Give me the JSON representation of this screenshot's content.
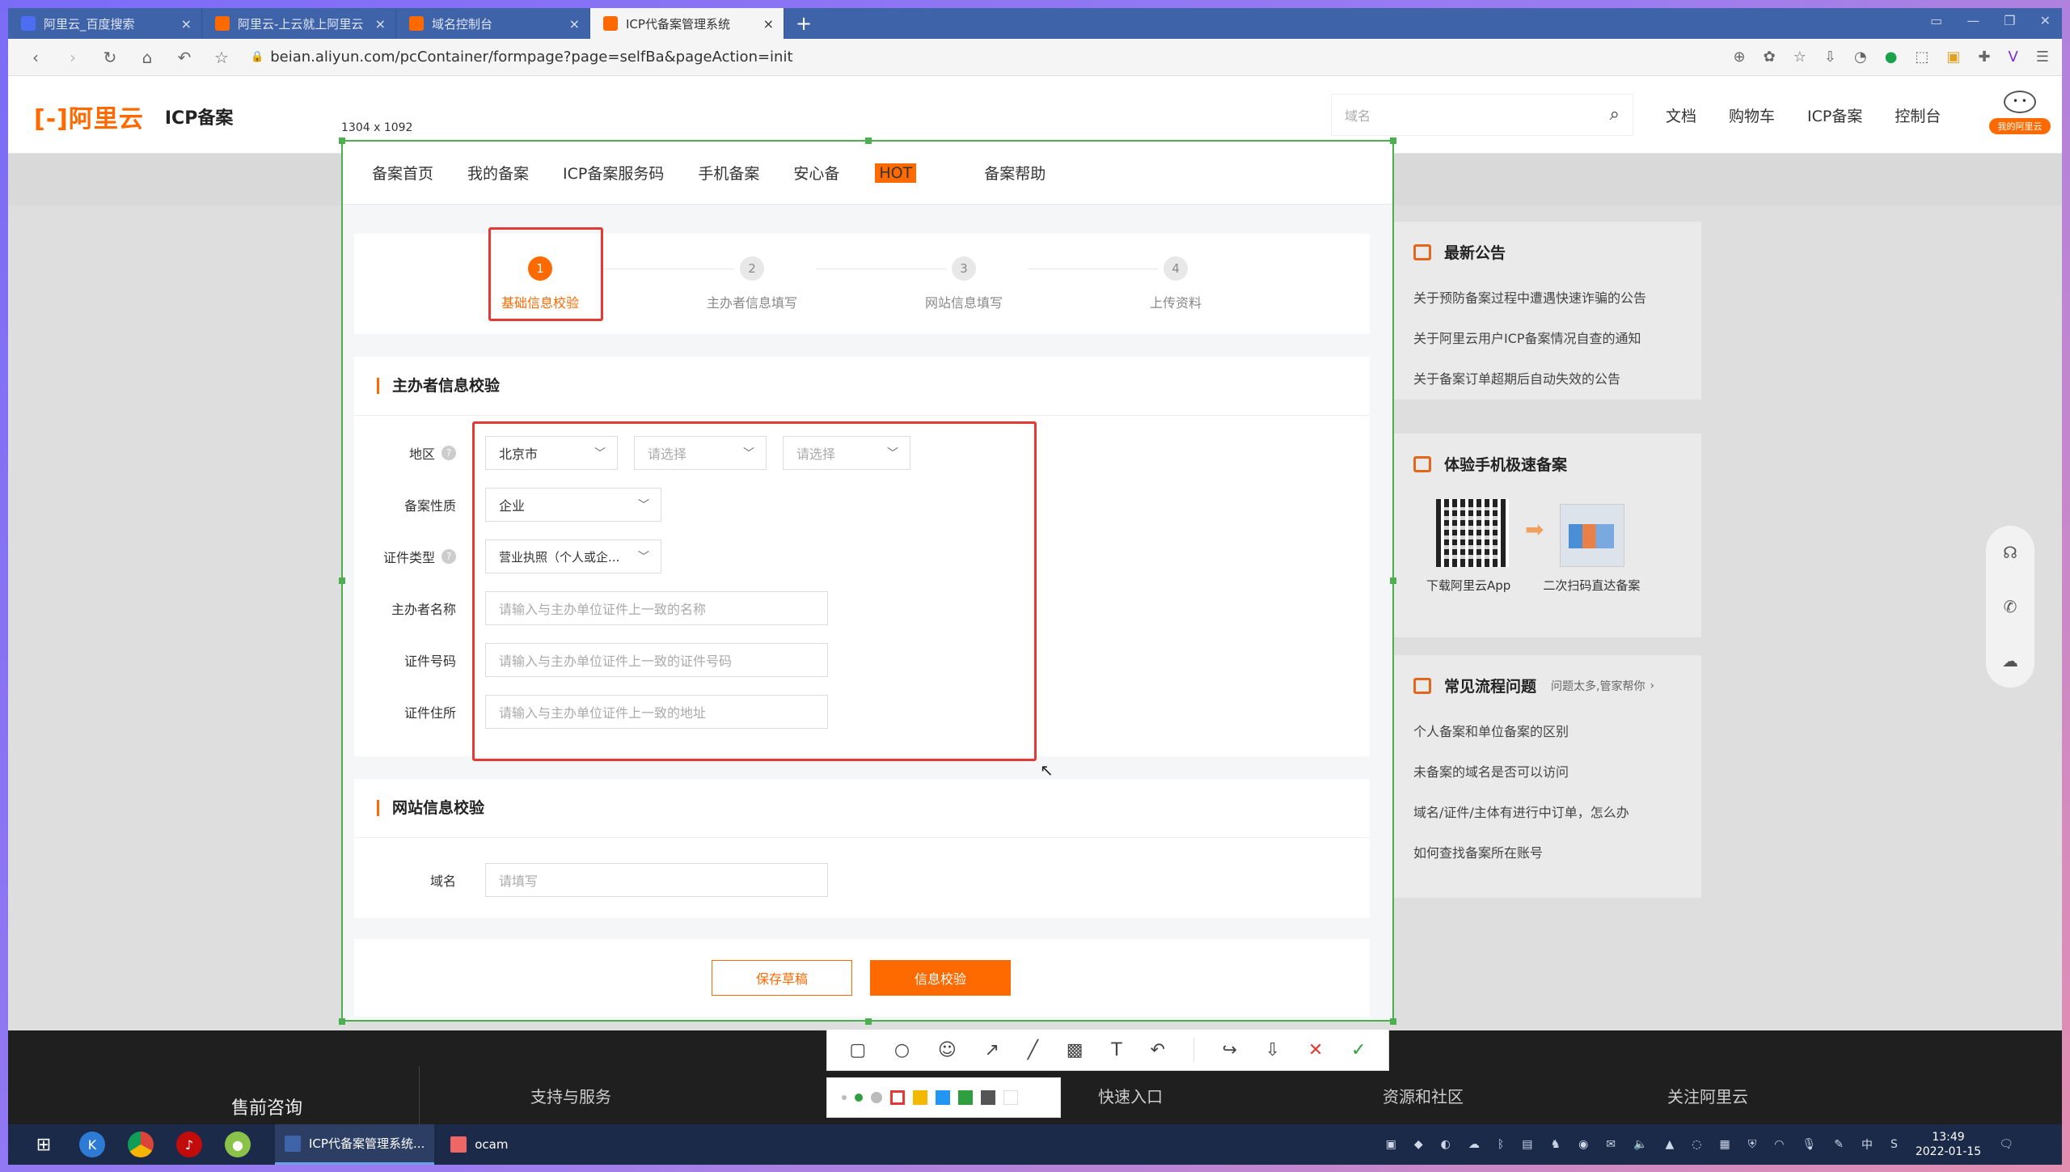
{
  "browser": {
    "tabs": [
      {
        "title": "阿里云_百度搜索",
        "active": false,
        "favicon_color": "#4e6ef2"
      },
      {
        "title": "阿里云-上云就上阿里云",
        "active": false,
        "favicon_color": "#ff6a00"
      },
      {
        "title": "域名控制台",
        "active": false,
        "favicon_color": "#ff6a00"
      },
      {
        "title": "ICP代备案管理系统",
        "active": true,
        "favicon_color": "#ff6a00"
      }
    ],
    "url": "beian.aliyun.com/pcContainer/formpage?page=selfBa&pageAction=init"
  },
  "site": {
    "logo": "[-]阿里云",
    "product": "ICP备案",
    "search_placeholder": "域名",
    "nav": [
      "文档",
      "购物车",
      "ICP备案",
      "控制台"
    ],
    "avatar_badge": "我的阿里云",
    "accent": "#ff6a00"
  },
  "selection": {
    "size_label": "1304 x 1092"
  },
  "subnav": [
    {
      "label": "备案首页"
    },
    {
      "label": "我的备案"
    },
    {
      "label": "ICP备案服务码"
    },
    {
      "label": "手机备案"
    },
    {
      "label": "安心备",
      "badge": "HOT"
    },
    {
      "label": "备案帮助"
    }
  ],
  "steps": [
    {
      "num": "1",
      "label": "基础信息校验",
      "active": true
    },
    {
      "num": "2",
      "label": "主办者信息填写",
      "active": false
    },
    {
      "num": "3",
      "label": "网站信息填写",
      "active": false
    },
    {
      "num": "4",
      "label": "上传资料",
      "active": false
    }
  ],
  "sponsor_section": {
    "title": "主办者信息校验",
    "region_label": "地区",
    "region_values": [
      "北京市",
      "请选择",
      "请选择"
    ],
    "nature_label": "备案性质",
    "nature_value": "企业",
    "cert_type_label": "证件类型",
    "cert_type_value": "营业执照（个人或企...",
    "name_label": "主办者名称",
    "name_placeholder": "请输入与主办单位证件上一致的名称",
    "cert_no_label": "证件号码",
    "cert_no_placeholder": "请输入与主办单位证件上一致的证件号码",
    "address_label": "证件住所",
    "address_placeholder": "请输入与主办单位证件上一致的地址"
  },
  "website_section": {
    "title": "网站信息校验",
    "domain_label": "域名",
    "domain_placeholder": "请填写"
  },
  "actions": {
    "save_draft": "保存草稿",
    "verify": "信息校验"
  },
  "sidebar": {
    "announcements_title": "最新公告",
    "announcements": [
      "关于预防备案过程中遭遇快速诈骗的公告",
      "关于阿里云用户ICP备案情况自查的通知",
      "关于备案订单超期后自动失效的公告"
    ],
    "mobile_title": "体验手机极速备案",
    "mobile_labels": [
      "下载阿里云App",
      "二次扫码直达备案"
    ],
    "faq_title": "常见流程问题",
    "faq_hint": "问题太多,管家帮你",
    "faq": [
      "个人备案和单位备案的区别",
      "未备案的域名是否可以访问",
      "域名/证件/主体有进行中订单，怎么办",
      "如何查找备案所在账号"
    ]
  },
  "footer": {
    "presale": "售前咨询",
    "columns": [
      "支持与服务",
      "快速入口",
      "资源和社区",
      "关注阿里云"
    ]
  },
  "taskbar": {
    "apps": [
      "ICP代备案管理系统...",
      "ocam"
    ],
    "ime": "中",
    "time": "13:49",
    "date": "2022-01-15"
  }
}
